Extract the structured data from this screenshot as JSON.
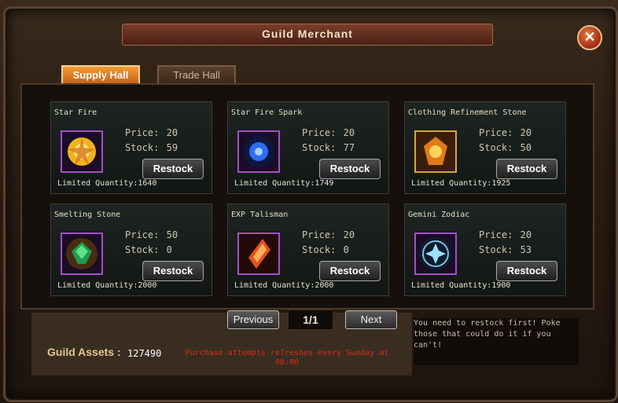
{
  "window": {
    "title": "Guild Merchant",
    "close_label": "✕"
  },
  "tabs": [
    {
      "label": "Supply Hall",
      "active": true
    },
    {
      "label": "Trade Hall",
      "active": false
    }
  ],
  "labels": {
    "price": "Price:",
    "stock": "Stock:",
    "restock": "Restock",
    "limited": "Limited Quantity:"
  },
  "items": [
    {
      "name": "Star Fire",
      "price": "20",
      "stock": "59",
      "limited": "1640",
      "icon": "star-fire-icon"
    },
    {
      "name": "Star Fire Spark",
      "price": "20",
      "stock": "77",
      "limited": "1749",
      "icon": "star-fire-spark-icon"
    },
    {
      "name": "Clothing Refinement Stone",
      "price": "20",
      "stock": "50",
      "limited": "1925",
      "icon": "clothing-refinement-stone-icon"
    },
    {
      "name": "Smelting Stone",
      "price": "50",
      "stock": "0",
      "limited": "2000",
      "icon": "smelting-stone-icon"
    },
    {
      "name": "EXP Talisman",
      "price": "20",
      "stock": "0",
      "limited": "2000",
      "icon": "exp-talisman-icon"
    },
    {
      "name": "Gemini Zodiac",
      "price": "20",
      "stock": "53",
      "limited": "1900",
      "icon": "gemini-zodiac-icon"
    }
  ],
  "pagination": {
    "previous": "Previous",
    "page": "1/1",
    "next": "Next"
  },
  "footer": {
    "assets_label": "Guild Assets :",
    "assets_value": "127490",
    "refresh_note": "Purchase attempts refreshes every Sunday at 00:00",
    "notice": "You need to restock first! Poke those that could do it if you can't!"
  }
}
